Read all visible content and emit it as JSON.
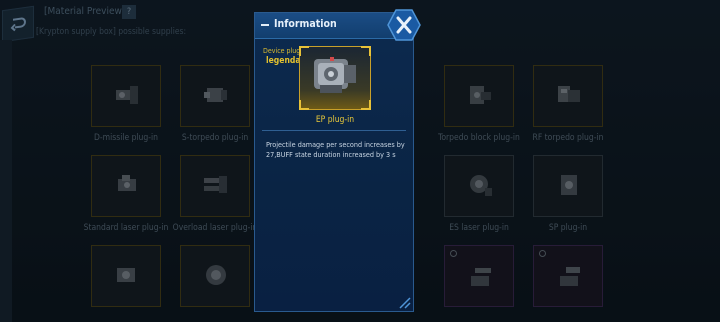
{
  "header": {
    "title": "[Material Preview]",
    "help_label": "?",
    "subtitle": "[Krypton supply box] possible supplies:"
  },
  "grid": {
    "row1": [
      {
        "label": "D-missile plug-in",
        "rarity": "legendary"
      },
      {
        "label": "S-torpedo plug-in",
        "rarity": "legendary"
      },
      {
        "label": "",
        "rarity": "legendary"
      },
      {
        "label": "Torpedo block plug-in",
        "rarity": "legendary"
      },
      {
        "label": "RF torpedo plug-in",
        "rarity": "legendary"
      }
    ],
    "row2": [
      {
        "label": "Standard laser plug-in",
        "rarity": "legendary"
      },
      {
        "label": "Overload laser plug-in",
        "rarity": "legendary"
      },
      {
        "label": "",
        "rarity": "legendary"
      },
      {
        "label": "ES laser plug-in",
        "rarity": "common"
      },
      {
        "label": "SP plug-in",
        "rarity": "common"
      }
    ],
    "row3": [
      {
        "label": "",
        "rarity": "legendary"
      },
      {
        "label": "",
        "rarity": "legendary"
      },
      {
        "label": "",
        "rarity": "legendary"
      },
      {
        "label": "",
        "rarity": "epic"
      },
      {
        "label": "",
        "rarity": "epic"
      }
    ]
  },
  "info_panel": {
    "title": "Information",
    "device_type": "Device plug-in",
    "rarity": "legendary",
    "item_name": "EP plug-in",
    "description": "Projectile damage per second increases by 27,BUFF state duration increased by 3 s"
  },
  "colors": {
    "legendary": "#e3c12f",
    "panel_blue": "#0d2a4f",
    "accent_blue": "#2b6aa6"
  },
  "icons": {
    "back": "back-arrow-icon",
    "close": "close-icon"
  }
}
